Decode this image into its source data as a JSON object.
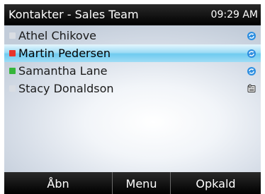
{
  "header": {
    "title": "Kontakter - Sales Team",
    "time": "09:29 AM"
  },
  "contacts": [
    {
      "name": "Athel Chikove",
      "status_color": "#d9dde3",
      "icon": "sync-icon"
    },
    {
      "name": "Martin Pedersen",
      "status_color": "#e8332a",
      "icon": "sync-icon"
    },
    {
      "name": "Samantha Lane",
      "status_color": "#35b53a",
      "icon": "sync-icon"
    },
    {
      "name": "Stacy Donaldson",
      "status_color": "#d9dde3",
      "icon": "phone-book-icon"
    }
  ],
  "selected_index": 1,
  "softkeys": {
    "left": "Åbn",
    "middle": "Menu",
    "right": "Opkald"
  },
  "colors": {
    "bar": "#000000",
    "selection": "#6fcbf0",
    "sync_icon": "#2f8fe0"
  }
}
